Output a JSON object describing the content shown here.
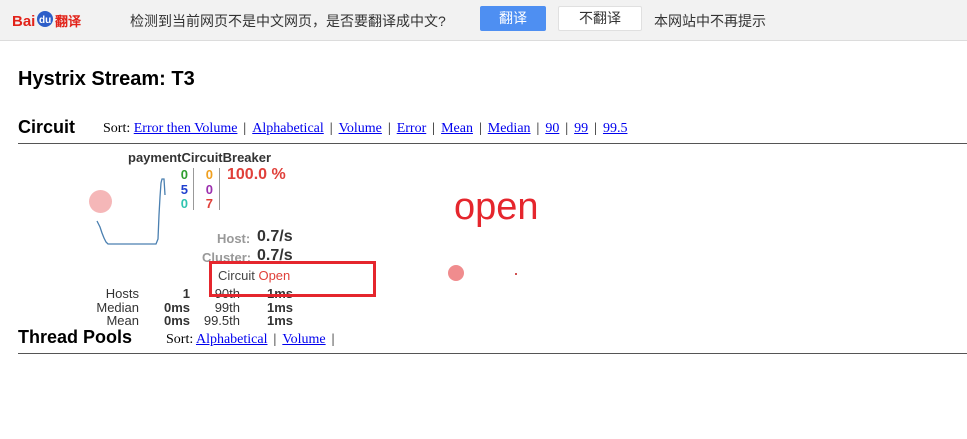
{
  "translate_bar": {
    "logo_text_bai": "Bai",
    "logo_text_du": "du",
    "logo_text_fanyi": "翻译",
    "message": "检测到当前网页不是中文网页，是否要翻译成中文?",
    "translate_button": "翻译",
    "no_translate_button": "不翻译",
    "never_translate": "本网站中不再提示"
  },
  "page": {
    "title": "Hystrix Stream: T3"
  },
  "circuit_section": {
    "title": "Circuit",
    "sort_label": "Sort:",
    "sort_links": [
      "Error then Volume",
      "Alphabetical",
      "Volume",
      "Error",
      "Mean",
      "Median",
      "90",
      "99",
      "99.5"
    ]
  },
  "circuit_breaker": {
    "name": "paymentCircuitBreaker",
    "counts": {
      "success": "0",
      "short_circuited": "5",
      "bad_request": "0",
      "timeout": "0",
      "rejected": "0",
      "failure": "7"
    },
    "error_percentage": "100.0 %",
    "host_label": "Host:",
    "host_rate": "0.7/s",
    "cluster_label": "Cluster:",
    "cluster_rate": "0.7/s",
    "circuit_label": "Circuit",
    "circuit_state": "Open",
    "stats": {
      "hosts_label": "Hosts",
      "hosts_value": "1",
      "median_label": "Median",
      "median_value": "0ms",
      "mean_label": "Mean",
      "mean_value": "0ms",
      "p90_label": "90th",
      "p90_value": "1ms",
      "p99_label": "99th",
      "p99_value": "1ms",
      "p995_label": "99.5th",
      "p995_value": "1ms"
    }
  },
  "thread_pools_section": {
    "title": "Thread Pools",
    "sort_label": "Sort:",
    "sort_links": [
      "Alphabetical",
      "Volume"
    ]
  },
  "annotation": {
    "text": "open"
  },
  "colors": {
    "annotation_red": "#e5262d",
    "link_blue": "#0000ee",
    "translate_button": "#4e8ff2",
    "sparkline": "#4a7fb0"
  }
}
